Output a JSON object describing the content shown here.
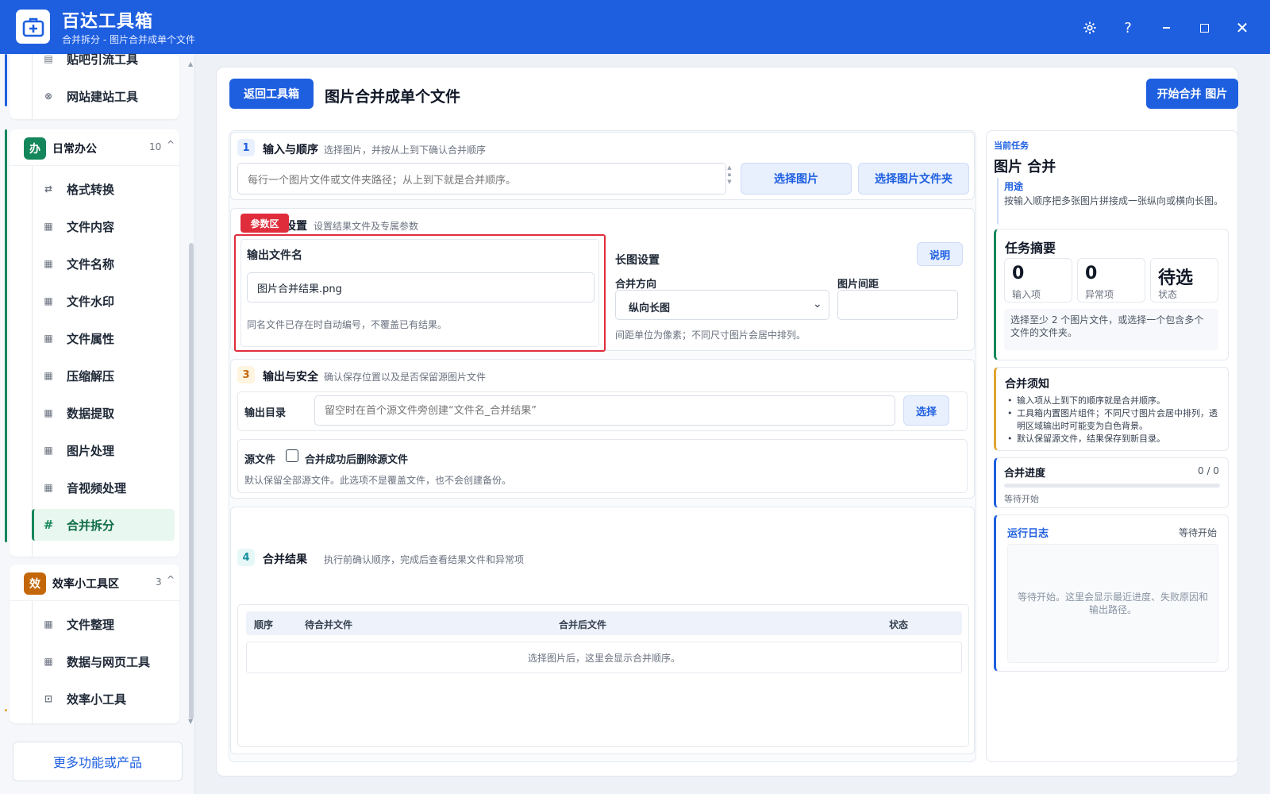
{
  "app": {
    "title": "百达工具箱",
    "subtitle": "合并拆分 - 图片合并成单个文件"
  },
  "sidebar": {
    "top_items": [
      {
        "label": "贴吧引流工具",
        "icon": "doc-icon"
      },
      {
        "label": "网站建站工具",
        "icon": "globe-icon"
      }
    ],
    "groups": [
      {
        "badge": "办",
        "badge_color": "#13865b",
        "title": "日常办公",
        "count": "10",
        "items": [
          "格式转换",
          "文件内容",
          "文件名称",
          "文件水印",
          "文件属性",
          "压缩解压",
          "数据提取",
          "图片处理",
          "音视频处理",
          "合并拆分"
        ],
        "active": "合并拆分"
      },
      {
        "badge": "效",
        "badge_color": "#c4670a",
        "title": "效率小工具区",
        "count": "3",
        "items": [
          "文件整理",
          "数据与网页工具",
          "效率小工具"
        ]
      }
    ],
    "more_button": "更多功能或产品"
  },
  "header": {
    "back_button": "返回工具箱",
    "page_title": "图片合并成单个文件",
    "start_button": "开始合并 图片"
  },
  "section1": {
    "num": "1",
    "title": "输入与顺序",
    "desc": "选择图片，并按从上到下确认合并顺序",
    "input_placeholder": "每行一个图片文件或文件夹路径；从上到下就是合并顺序。",
    "btn_select_images": "选择图片",
    "btn_select_folder": "选择图片文件夹"
  },
  "section2": {
    "tag": "参数区",
    "title": "设置",
    "desc": "设置结果文件及专属参数",
    "output_name_label": "输出文件名",
    "output_name_value": "图片合并结果.png",
    "output_name_note": "同名文件已存在时自动编号，不覆盖已有结果。",
    "long_image_label": "长图设置",
    "help_button": "说明",
    "direction_label": "合并方向",
    "direction_value": "纵向长图",
    "spacing_label": "图片间距",
    "spacing_value": "",
    "spacing_note": "间距单位为像素；不同尺寸图片会居中排列。"
  },
  "section3": {
    "num": "3",
    "title": "输出与安全",
    "desc": "确认保存位置以及是否保留源图片文件",
    "output_dir_label": "输出目录",
    "output_dir_placeholder": "留空时在首个源文件旁创建“文件名_合并结果”",
    "choose_button": "选择",
    "source_label": "源文件",
    "delete_checkbox_label": "合并成功后删除源文件",
    "delete_checked": false,
    "source_note": "默认保留全部源文件。此选项不是覆盖文件，也不会创建备份。"
  },
  "section4": {
    "num": "4",
    "title": "合并结果",
    "desc": "执行前确认顺序，完成后查看结果文件和异常项",
    "columns": [
      "顺序",
      "待合并文件",
      "合并后文件",
      "状态"
    ],
    "empty_text": "选择图片后，这里会显示合并顺序。"
  },
  "right": {
    "task_label": "当前任务",
    "task_title": "图片 合并",
    "purpose_label": "用途",
    "purpose_text": "按输入顺序把多张图片拼接成一张纵向或横向长图。",
    "summary_title": "任务摘要",
    "stats": [
      {
        "value": "0",
        "label": "输入项"
      },
      {
        "value": "0",
        "label": "异常项"
      },
      {
        "value": "待选",
        "label": "状态"
      }
    ],
    "summary_note": "选择至少 2 个图片文件，或选择一个包含多个文件的文件夹。",
    "notice_title": "合并须知",
    "notice_items": [
      "输入项从上到下的顺序就是合并顺序。",
      "工具箱内置图片组件；不同尺寸图片会居中排列，透明区域输出时可能变为白色背景。",
      "默认保留源文件，结果保存到新目录。"
    ],
    "progress_title": "合并进度",
    "progress_count": "0 / 0",
    "progress_value": 0,
    "progress_status": "等待开始",
    "log_title": "运行日志",
    "log_status": "等待开始",
    "log_text": "等待开始。这里会显示最近进度、失败原因和输出路径。"
  },
  "colors": {
    "brand": "#1e5fe0",
    "highlight": "#e02d3c",
    "active_green": "#15875a"
  }
}
